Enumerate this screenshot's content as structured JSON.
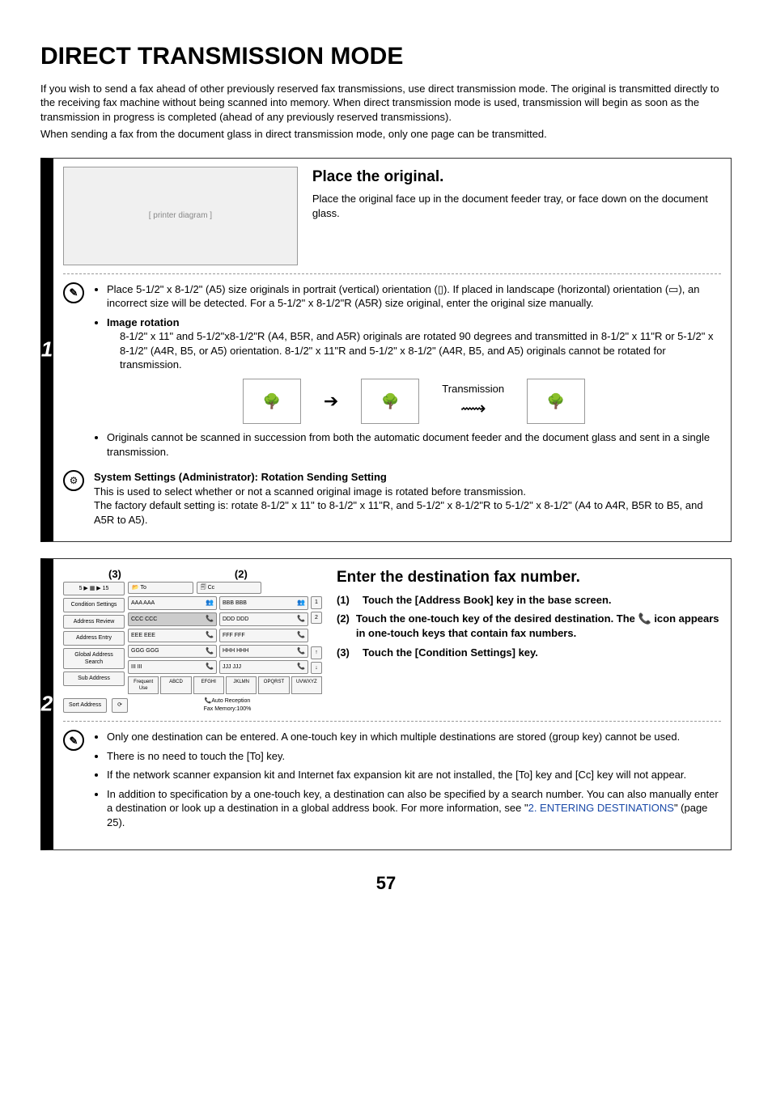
{
  "title": "DIRECT TRANSMISSION MODE",
  "intro": {
    "p1": "If you wish to send a fax ahead of other previously reserved fax transmissions, use direct transmission mode. The original is transmitted directly to the receiving fax machine without being scanned into memory. When direct transmission mode is used, transmission will begin as soon as the transmission in progress is completed (ahead of any previously reserved transmissions).",
    "p2": "When sending a fax from the document glass in direct transmission mode, only one page can be transmitted."
  },
  "step1": {
    "number": "1",
    "heading": "Place the original.",
    "desc": "Place the original face up in the document feeder tray, or face down on the document glass.",
    "bullet1a": "Place 5-1/2\" x 8-1/2\" (A5) size originals in portrait (vertical) orientation (",
    "bullet1b": "). If placed in landscape (horizontal) orientation (",
    "bullet1c": "), an incorrect size will be detected. For a 5-1/2\" x 8-1/2\"R (A5R) size original, enter the original size manually.",
    "rotationLabel": "Image rotation",
    "rotationText": "8-1/2\" x 11\" and 5-1/2\"x8-1/2\"R (A4, B5R, and A5R) originals are rotated 90 degrees and transmitted in 8-1/2\" x 11\"R or 5-1/2\" x 8-1/2\" (A4R, B5, or A5) orientation. 8-1/2\" x 11\"R and 5-1/2\" x 8-1/2\" (A4R, B5, and A5) originals cannot be rotated for transmission.",
    "transmissionLabel": "Transmission",
    "bullet3": "Originals cannot be scanned in succession from both the automatic document feeder and the document glass and sent in a single transmission.",
    "adminTitle": "System Settings (Administrator): Rotation Sending Setting",
    "adminText1": "This is used to select whether or not a scanned original image is rotated before transmission.",
    "adminText2": "The factory default setting is: rotate 8-1/2\" x 11\" to 8-1/2\" x 11\"R, and 5-1/2\" x 8-1/2\"R to 5-1/2\" x 8-1/2\" (A4 to A4R, B5R to B5, and A5R to A5)."
  },
  "step2": {
    "number": "2",
    "label3": "(3)",
    "label2": "(2)",
    "heading": "Enter the destination fax number.",
    "i1n": "(1)",
    "i1": "Touch the [Address Book] key in the base screen.",
    "i2n": "(2)",
    "i2a": "Touch the one-touch key of the desired destination. The ",
    "i2b": " icon appears in one-touch keys that contain fax numbers.",
    "i3n": "(3)",
    "i3": "Touch the [Condition Settings] key.",
    "note1": "Only one destination can be entered. A one-touch key in which multiple destinations are stored (group key) cannot be used.",
    "note2": "There is no need to touch the [To] key.",
    "note3": "If the network scanner expansion kit and Internet fax expansion kit are not installed, the [To] key and [Cc] key will not appear.",
    "note4a": "In addition to specification by a one-touch key, a destination can also be specified by a search number. You can also manually enter a destination or look up a destination in a global address book. For more information, see \"",
    "note4link": "2. ENTERING DESTINATIONS",
    "note4b": "\" (page 25)."
  },
  "screen": {
    "breadcrumb": "5 ▶ ▦ ▶ 15",
    "to": "To",
    "cc": "Cc",
    "side": {
      "cond": "Condition Settings",
      "review": "Address Review",
      "entry": "Address Entry",
      "global": "Global Address Search",
      "sub": "Sub Address"
    },
    "addr": {
      "a": "AAA AAA",
      "b": "BBB BBB",
      "c": "CCC CCC",
      "d": "DDD DDD",
      "e": "EEE EEE",
      "f": "FFF FFF",
      "g": "GGG GGG",
      "h": "HHH HHH",
      "i": "III III",
      "j": "JJJ JJJ"
    },
    "page1": "1",
    "page2": "2",
    "up": "↑",
    "down": "↓",
    "tabs": {
      "freq": "Frequent Use",
      "a": "ABCD",
      "e": "EFGHI",
      "j": "JKLMN",
      "o": "OPQRST",
      "u": "UVWXYZ"
    },
    "sort": "Sort Address",
    "status1": "Auto Reception",
    "status2": "Fax Memory:100%"
  },
  "pageNumber": "57"
}
